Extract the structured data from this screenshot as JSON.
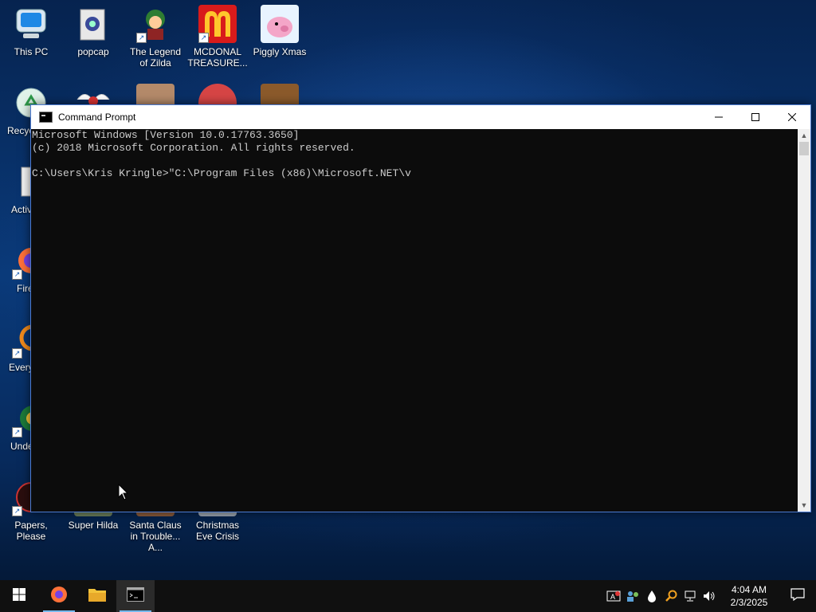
{
  "desktop": {
    "icons": [
      {
        "label": "This PC",
        "icon": "this-pc-icon"
      },
      {
        "label": "popcap",
        "icon": "folder-icon"
      },
      {
        "label": "The Legend of Zilda",
        "icon": "game-icon"
      },
      {
        "label": "MCDONAL TREASURE...",
        "icon": "mcdonalds-icon"
      },
      {
        "label": "Piggly Xmas",
        "icon": "pig-icon"
      },
      {
        "label": "Recyc",
        "icon": "recycle-bin-icon"
      },
      {
        "label": "Activ",
        "icon": "document-icon"
      },
      {
        "label": "Fire",
        "icon": "firefox-icon"
      },
      {
        "label": "Every",
        "icon": "game-icon"
      },
      {
        "label": "Unde",
        "icon": "game-icon"
      },
      {
        "label": "Papers, Please",
        "icon": "game-icon"
      },
      {
        "label": "Super Hilda",
        "icon": "game-icon"
      },
      {
        "label": "Santa Claus in Trouble... A...",
        "icon": "game-icon"
      },
      {
        "label": "Christmas Eve Crisis",
        "icon": "game-icon"
      }
    ]
  },
  "window": {
    "title": "Command Prompt",
    "minimize_glyph": "—",
    "maximize_glyph": "☐",
    "close_glyph": "✕",
    "console_lines": [
      "Microsoft Windows [Version 10.0.17763.3650]",
      "(c) 2018 Microsoft Corporation. All rights reserved.",
      "",
      "C:\\Users\\Kris Kringle>\"C:\\Program Files (x86)\\Microsoft.NET\\v"
    ]
  },
  "taskbar": {
    "clock_time": "4:04 AM",
    "clock_date": "2/3/2025"
  },
  "colors": {
    "console_bg": "#0c0c0c",
    "console_text": "#cccccc",
    "taskbar_bg": "#101010",
    "accent": "#76b9ed"
  }
}
